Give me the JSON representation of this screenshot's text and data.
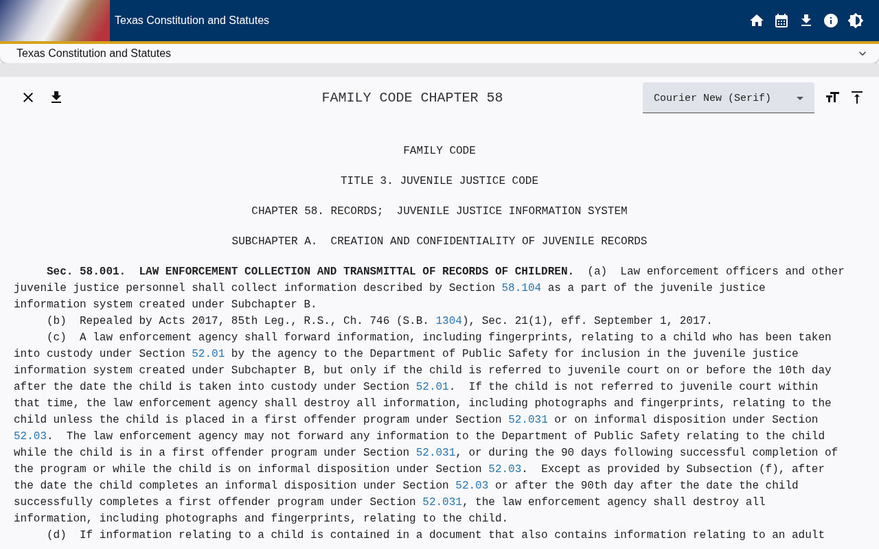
{
  "app_bar": {
    "title": "Texas Constitution and Statutes"
  },
  "breadcrumb_panel": {
    "title": "Texas Constitution and Statutes",
    "expanded": false
  },
  "document_toolbar": {
    "title": "FAMILY CODE CHAPTER 58",
    "font_select": {
      "value": "Courier New (Serif)"
    }
  },
  "document": {
    "headings": [
      "FAMILY CODE",
      "TITLE 3. JUVENILE JUSTICE CODE",
      "CHAPTER 58. RECORDS;  JUVENILE JUSTICE INFORMATION SYSTEM",
      "SUBCHAPTER A.  CREATION AND CONFIDENTIALITY OF JUVENILE RECORDS"
    ],
    "paragraphs": [
      {
        "lines": [
          [
            {
              "kind": "bold",
              "text": "Sec. 58.001.  LAW ENFORCEMENT COLLECTION AND TRANSMITTAL OF RECORDS OF CHILDREN."
            },
            {
              "kind": "plain",
              "text": "  (a)  Law enforcement officers and other"
            }
          ],
          [
            {
              "kind": "plain",
              "text": "juvenile justice personnel shall collect information described by Section "
            },
            {
              "kind": "link",
              "text": "58.104"
            },
            {
              "kind": "plain",
              "text": " as a part of the juvenile justice"
            }
          ],
          [
            {
              "kind": "plain",
              "text": "information system created under Subchapter B."
            }
          ]
        ]
      },
      {
        "lines": [
          [
            {
              "kind": "plain",
              "text": "(b)  Repealed by Acts 2017, 85th Leg., R.S., Ch. 746 (S.B. "
            },
            {
              "kind": "link",
              "text": "1304"
            },
            {
              "kind": "plain",
              "text": "), Sec. 21(1), eff. September 1, 2017."
            }
          ]
        ]
      },
      {
        "lines": [
          [
            {
              "kind": "plain",
              "text": "(c)  A law enforcement agency shall forward information, including fingerprints, relating to a child who has been taken"
            }
          ],
          [
            {
              "kind": "plain",
              "text": "into custody under Section "
            },
            {
              "kind": "link",
              "text": "52.01"
            },
            {
              "kind": "plain",
              "text": " by the agency to the Department of Public Safety for inclusion in the juvenile justice"
            }
          ],
          [
            {
              "kind": "plain",
              "text": "information system created under Subchapter B, but only if the child is referred to juvenile court on or before the 10th day"
            }
          ],
          [
            {
              "kind": "plain",
              "text": "after the date the child is taken into custody under Section "
            },
            {
              "kind": "link",
              "text": "52.01"
            },
            {
              "kind": "plain",
              "text": ".  If the child is not referred to juvenile court within"
            }
          ],
          [
            {
              "kind": "plain",
              "text": "that time, the law enforcement agency shall destroy all information, including photographs and fingerprints, relating to the"
            }
          ],
          [
            {
              "kind": "plain",
              "text": "child unless the child is placed in a first offender program under Section "
            },
            {
              "kind": "link",
              "text": "52.031"
            },
            {
              "kind": "plain",
              "text": " or on informal disposition under Section"
            }
          ],
          [
            {
              "kind": "link",
              "text": "52.03"
            },
            {
              "kind": "plain",
              "text": ".  The law enforcement agency may not forward any information to the Department of Public Safety relating to the child"
            }
          ],
          [
            {
              "kind": "plain",
              "text": "while the child is in a first offender program under Section "
            },
            {
              "kind": "link",
              "text": "52.031"
            },
            {
              "kind": "plain",
              "text": ", or during the 90 days following successful completion of"
            }
          ],
          [
            {
              "kind": "plain",
              "text": "the program or while the child is on informal disposition under Section "
            },
            {
              "kind": "link",
              "text": "52.03"
            },
            {
              "kind": "plain",
              "text": ".  Except as provided by Subsection (f), after"
            }
          ],
          [
            {
              "kind": "plain",
              "text": "the date the child completes an informal disposition under Section "
            },
            {
              "kind": "link",
              "text": "52.03"
            },
            {
              "kind": "plain",
              "text": " or after the 90th day after the date the child"
            }
          ],
          [
            {
              "kind": "plain",
              "text": "successfully completes a first offender program under Section "
            },
            {
              "kind": "link",
              "text": "52.031"
            },
            {
              "kind": "plain",
              "text": ", the law enforcement agency shall destroy all"
            }
          ],
          [
            {
              "kind": "plain",
              "text": "information, including photographs and fingerprints, relating to the child."
            }
          ]
        ]
      },
      {
        "lines": [
          [
            {
              "kind": "plain",
              "text": "(d)  If information relating to a child is contained in a document that also contains information relating to an adult"
            }
          ]
        ]
      }
    ]
  }
}
